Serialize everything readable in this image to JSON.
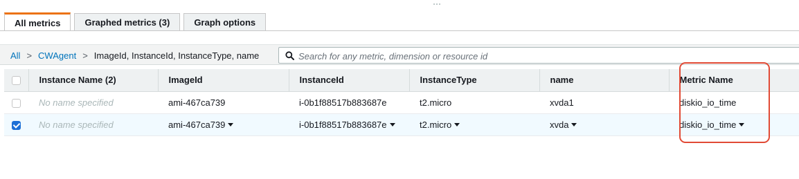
{
  "tabs": [
    {
      "label": "All metrics",
      "active": true
    },
    {
      "label": "Graphed metrics (3)",
      "active": false
    },
    {
      "label": "Graph options",
      "active": false
    }
  ],
  "breadcrumb": {
    "root": "All",
    "namespace": "CWAgent",
    "dimensions": "ImageId, InstanceId, InstanceType, name",
    "separator": ">"
  },
  "search": {
    "placeholder": "Search for any metric, dimension or resource id",
    "icon": "search-icon"
  },
  "table": {
    "columns": [
      "Instance Name (2)",
      "ImageId",
      "InstanceId",
      "InstanceType",
      "name",
      "Metric Name"
    ],
    "rows": [
      {
        "checked": false,
        "instance_name": "No name specified",
        "image_id": "ami-467ca739",
        "instance_id": "i-0b1f88517b883687e",
        "instance_type": "t2.micro",
        "name": "xvda1",
        "metric_name": "diskio_io_time",
        "dropdowns": false
      },
      {
        "checked": true,
        "instance_name": "No name specified",
        "image_id": "ami-467ca739",
        "instance_id": "i-0b1f88517b883687e",
        "instance_type": "t2.micro",
        "name": "xvda",
        "metric_name": "diskio_io_time",
        "dropdowns": true
      }
    ]
  },
  "colors": {
    "active_tab_accent": "#ec7211",
    "link": "#0073bb",
    "checkbox_checked": "#1d6fd6",
    "highlight_box": "#e14a35"
  }
}
